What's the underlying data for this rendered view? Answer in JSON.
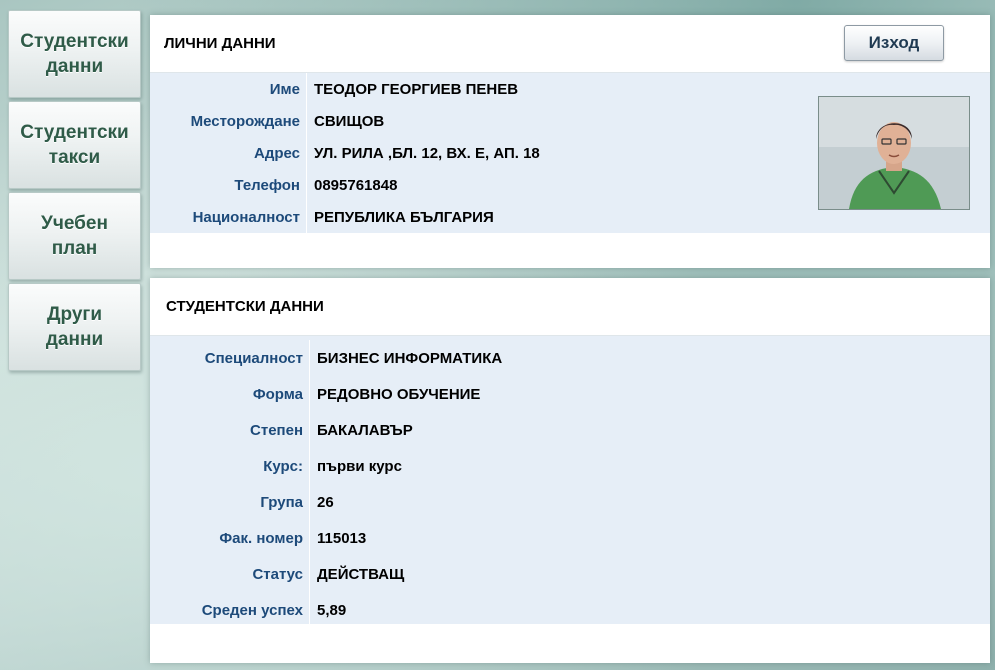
{
  "nav": {
    "items": [
      {
        "label": "Студентски\nданни"
      },
      {
        "label": "Студентски\nтакси"
      },
      {
        "label": "Учебен\nплан"
      },
      {
        "label": "Други\nданни"
      }
    ]
  },
  "personal": {
    "title": "ЛИЧНИ ДАННИ",
    "logout_label": "Изход",
    "fields": [
      {
        "label": "Име",
        "value": "ТЕОДОР ГЕОРГИЕВ ПЕНЕВ"
      },
      {
        "label": "Месторождане",
        "value": "СВИЩОВ"
      },
      {
        "label": "Адрес",
        "value": "УЛ. РИЛА ,БЛ. 12, ВХ. Е, АП. 18"
      },
      {
        "label": "Телефон",
        "value": "0895761848"
      },
      {
        "label": "Националност",
        "value": "РЕПУБЛИКА БЪЛГАРИЯ"
      }
    ]
  },
  "student": {
    "title": "СТУДЕНТСКИ ДАННИ",
    "fields": [
      {
        "label": "Специалност",
        "value": "БИЗНЕС ИНФОРМАТИКА"
      },
      {
        "label": "Форма",
        "value": "РЕДОВНО ОБУЧЕНИЕ"
      },
      {
        "label": "Степен",
        "value": "БАКАЛАВЪР"
      },
      {
        "label": "Курс:",
        "value": "първи курс"
      },
      {
        "label": "Група",
        "value": "26"
      },
      {
        "label": "Фак. номер",
        "value": "115013"
      },
      {
        "label": "Статус",
        "value": "ДЕЙСТВАЩ"
      },
      {
        "label": "Среден успех",
        "value": "5,89"
      }
    ]
  },
  "colors": {
    "label_blue": "#1d4a7a",
    "nav_text_green": "#2f5b48",
    "info_background": "#e6eef7"
  }
}
